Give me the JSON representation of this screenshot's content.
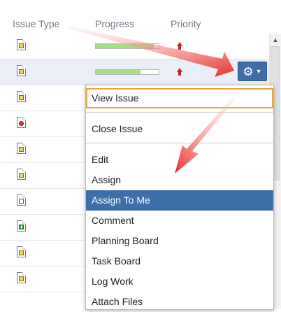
{
  "table": {
    "columns": [
      "Issue Type",
      "Progress",
      "Priority"
    ],
    "rows": [
      {
        "type": "task",
        "progress": 0.92,
        "priority": "high"
      },
      {
        "type": "task",
        "progress": 0.71,
        "priority": "high",
        "selected": true
      },
      {
        "type": "task"
      },
      {
        "type": "bug"
      },
      {
        "type": "task"
      },
      {
        "type": "task"
      },
      {
        "type": "story"
      },
      {
        "type": "new-feature"
      },
      {
        "type": "task"
      },
      {
        "type": "task"
      }
    ]
  },
  "actions_button": {
    "icon": "gear-icon",
    "caret": "chevron-down-icon"
  },
  "menu": {
    "items": [
      "View Issue",
      "Close Issue",
      "Edit",
      "Assign",
      "Assign To Me",
      "Comment",
      "Planning Board",
      "Task Board",
      "Log Work",
      "Attach Files"
    ],
    "highlighted": "Assign To Me",
    "focused": "View Issue"
  },
  "colors": {
    "accent": "#3d6ea8",
    "progress_fill": "#a6dd86",
    "priority": "#c12b2b",
    "focus_border": "#e8a640",
    "annotation_arrow": "#e8302a"
  }
}
